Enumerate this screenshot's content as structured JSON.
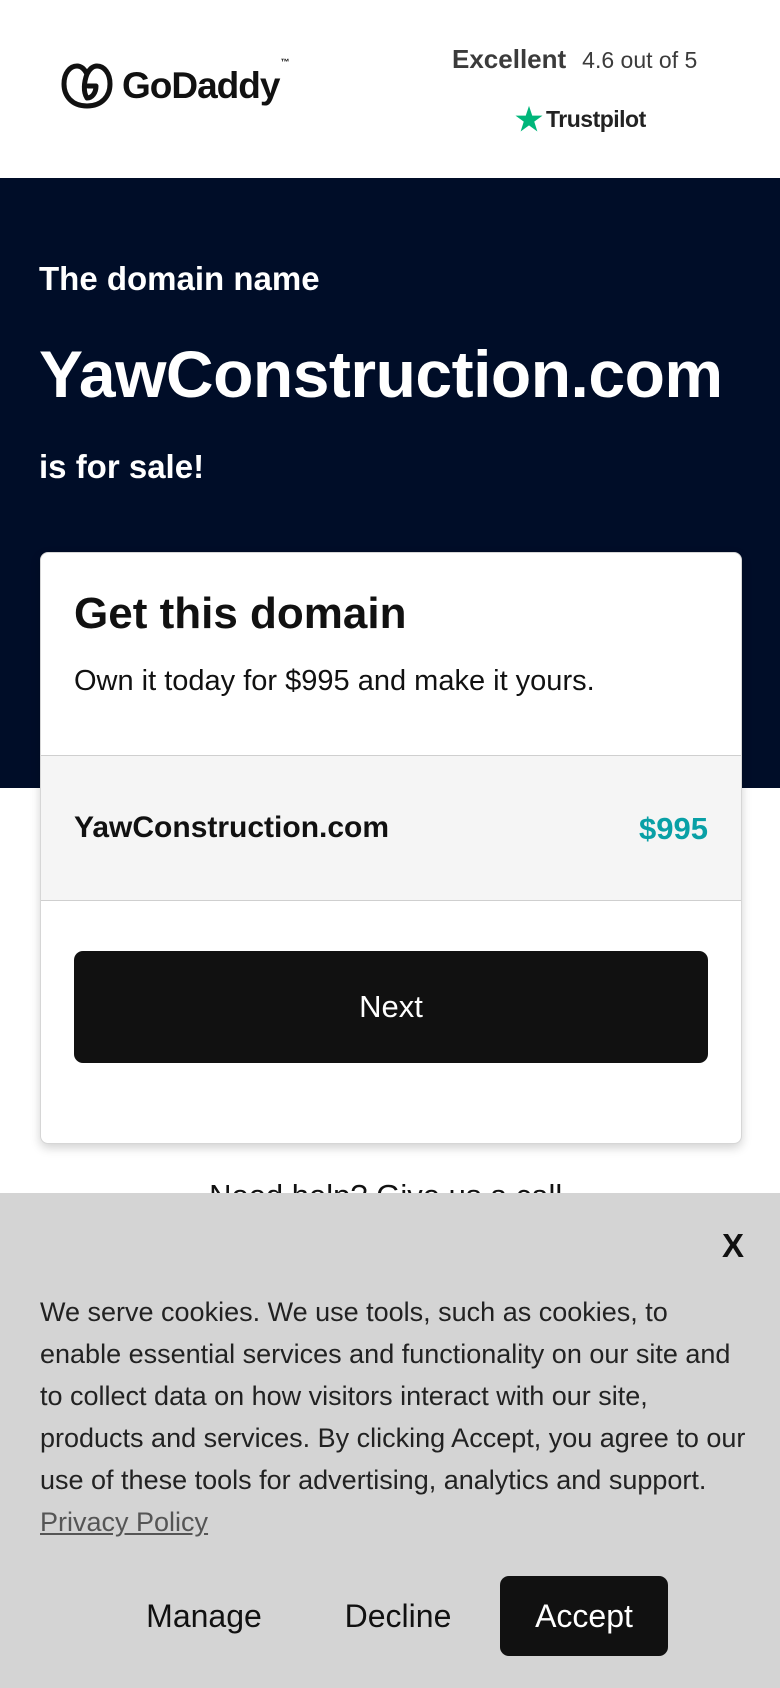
{
  "header": {
    "logo_text": "GoDaddy",
    "logo_tm": "™",
    "rating_word": "Excellent",
    "rating_score": "4.6 out of 5",
    "trustpilot_label": "Trustpilot"
  },
  "hero": {
    "intro": "The domain name",
    "domain": "YawConstruction.com",
    "sale": "is for sale!"
  },
  "card": {
    "title": "Get this domain",
    "subtitle": "Own it today for $995 and make it yours.",
    "row_domain": "YawConstruction.com",
    "row_price": "$995",
    "next_label": "Next"
  },
  "help_text": "Need help? Give us a call.",
  "cookie": {
    "close_label": "X",
    "text": "We serve cookies. We use tools, such as cookies, to enable essential services and functionality on our site and to collect data on how visitors interact with our site, products and services. By clicking Accept, you agree to our use of these tools for advertising, analytics and support.",
    "privacy_link": "Privacy Policy",
    "manage_label": "Manage",
    "decline_label": "Decline",
    "accept_label": "Accept"
  },
  "colors": {
    "hero_bg": "#000d28",
    "price": "#09a0a6",
    "trustpilot_star": "#00b67a",
    "button": "#111111",
    "cookie_bg": "#d4d4d4"
  },
  "icons": {
    "logo": "godaddy-logo-icon",
    "trustpilot": "trustpilot-star-icon"
  }
}
